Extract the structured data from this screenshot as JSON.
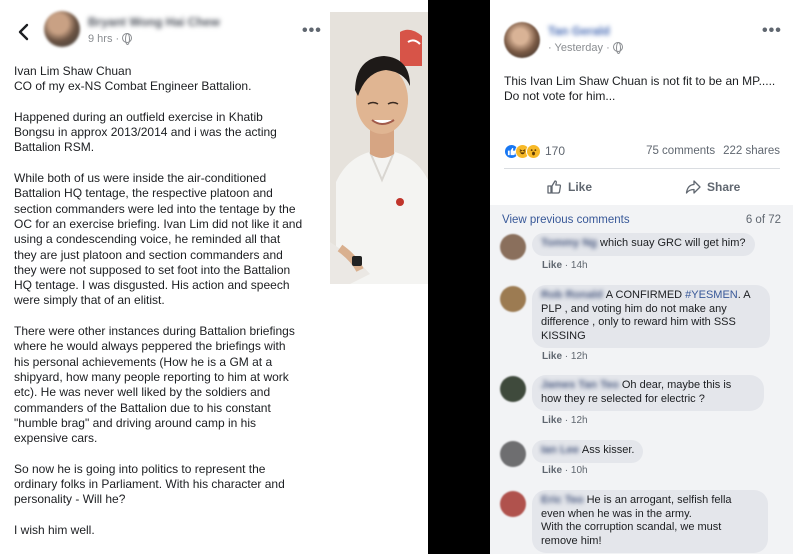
{
  "left_post": {
    "author": "Bryant Wong Hai Chew",
    "time": "9 hrs · ",
    "more": "•••",
    "paragraphs": [
      "Ivan Lim Shaw Chuan\nCO of my ex-NS Combat Engineer Battalion.",
      "Happened during an outfield exercise in Khatib\nBongsu in approx 2013/2014 and i was the acting\nBattalion RSM.",
      "While both of us were inside the air-conditioned\nBattalion HQ tentage, the respective platoon and\nsection commanders were led into the tentage by the\nOC for an exercise briefing. Ivan Lim did not like it and\nusing a condescending voice, he reminded all that\nthey are just platoon and section commanders and\nthey were not supposed to set foot into the Battalion\nHQ tentage. I was disgusted. His action and speech\nwere simply that of an elitist.",
      "There were other instances during Battalion briefings\nwhere he would always peppered the briefings with\nhis personal achievements (How he is a GM at a\nshipyard, how many people reporting to him at work\netc). He was never well liked by the soldiers and\ncommanders of the Battalion due to his constant\n\"humble brag\"  and driving around camp in his\nexpensive cars.",
      "So now he is going into politics to represent the\nordinary folks in Parliament. With his character and\npersonality - Will he?",
      "I wish him well."
    ]
  },
  "right_post": {
    "author": "Tan Gerald",
    "time": "· Yesterday · ",
    "more": "•••",
    "text": "This Ivan Lim Shaw Chuan is not fit to be an MP.....\nDo not vote for him...",
    "reaction_count": "170",
    "comments_count": "75 comments",
    "shares_count": "222 shares",
    "like_label": "Like",
    "share_label": "Share",
    "view_previous": "View previous comments",
    "page_count": "6 of 72",
    "comments": [
      {
        "name": "Tommy Ng",
        "text": "which suay GRC will get him?",
        "like": "Like",
        "time": " · 14h",
        "avatar_color": "#8a6f5c"
      },
      {
        "name": "Rob Ronald",
        "text_before": "A CONFIRMED ",
        "tag": "#YESMEN",
        "text_after": ". A\nPLP , and voting him do not make any\ndifference , only to reward him with SSS\nKISSING",
        "like": "Like",
        "time": " · 12h",
        "avatar_color": "#9c7b52"
      },
      {
        "name": "James Tan Teo",
        "text": "Oh dear, maybe this is\nhow they re selected for electric ?",
        "like": "Like",
        "time": " · 12h",
        "avatar_color": "#3f4a3c"
      },
      {
        "name": "Ian Lee",
        "text": "Ass kisser.",
        "like": "Like",
        "time": " · 10h",
        "avatar_color": "#6e6e70"
      },
      {
        "name": "Eric Teo",
        "text": "He is an arrogant, selfish fella\neven when he was in the army.\nWith the corruption scandal, we must\nremove him!",
        "like": "",
        "time": "",
        "avatar_color": "#b0524d"
      }
    ]
  }
}
